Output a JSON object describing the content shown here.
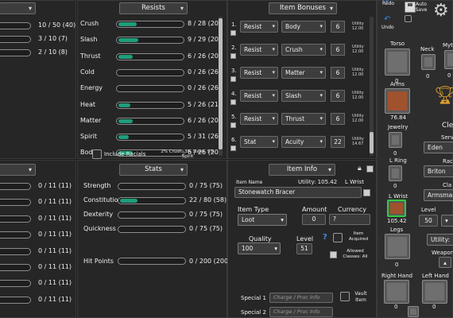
{
  "top_left": {
    "values": [
      "10 / 50 (40)",
      "3 / 10 (7)",
      "2 / 10 (8)"
    ]
  },
  "resists": {
    "header": "Resists",
    "rows": [
      {
        "label": "Crush",
        "value": "8 / 28 (20)",
        "fill": 0.29
      },
      {
        "label": "Slash",
        "value": "9 / 29 (20)",
        "fill": 0.31
      },
      {
        "label": "Thrust",
        "value": "6 / 26 (20)",
        "fill": 0.23
      },
      {
        "label": "Cold",
        "value": "0 / 26 (26)",
        "fill": 0
      },
      {
        "label": "Energy",
        "value": "0 / 26 (26)",
        "fill": 0
      },
      {
        "label": "Heat",
        "value": "5 / 26 (21)",
        "fill": 0.19
      },
      {
        "label": "Matter",
        "value": "6 / 26 (20)",
        "fill": 0.23
      },
      {
        "label": "Spirit",
        "value": "5 / 31 (26)",
        "fill": 0.16
      },
      {
        "label": "Body",
        "value": "6 / 26 (20)",
        "fill": 0.23
      }
    ],
    "include_racials": "Include Racials",
    "racial_note": "2% Crush, 3% Slash, 5% Spirit"
  },
  "item_bonuses": {
    "header": "Item Bonuses",
    "rows": [
      {
        "num": "1.",
        "type": "Resist",
        "target": "Body",
        "value": "6",
        "utility_label": "Utility",
        "utility": "12.00"
      },
      {
        "num": "2.",
        "type": "Resist",
        "target": "Crush",
        "value": "6",
        "utility_label": "Utility",
        "utility": "12.00"
      },
      {
        "num": "3.",
        "type": "Resist",
        "target": "Matter",
        "value": "6",
        "utility_label": "Utility",
        "utility": "12.00"
      },
      {
        "num": "4.",
        "type": "Resist",
        "target": "Slash",
        "value": "6",
        "utility_label": "Utility",
        "utility": "12.00"
      },
      {
        "num": "5.",
        "type": "Resist",
        "target": "Thrust",
        "value": "6",
        "utility_label": "Utility",
        "utility": "12.00"
      },
      {
        "num": "6.",
        "type": "Stat",
        "target": "Acuity",
        "value": "22",
        "utility_label": "Utility",
        "utility": "14.67"
      }
    ]
  },
  "toolbar": {
    "redo": "Redo",
    "auto_save": "Auto Save",
    "undo": "Undo"
  },
  "bottom_left": {
    "values": [
      "0 / 11 (11)",
      "0 / 11 (11)",
      "0 / 11 (11)",
      "0 / 11 (11)",
      "0 / 11 (11)",
      "0 / 11 (11)",
      "0 / 11 (11)",
      "0 / 11 (11)"
    ]
  },
  "stats": {
    "header": "Stats",
    "rows": [
      {
        "label": "Strength",
        "value": "0 / 75 (75)",
        "fill": 0
      },
      {
        "label": "Constitution",
        "value": "22 / 80 (58)",
        "fill": 0.275
      },
      {
        "label": "Dexterity",
        "value": "0 / 75 (75)",
        "fill": 0
      },
      {
        "label": "Quickness",
        "value": "0 / 75 (75)",
        "fill": 0
      }
    ],
    "hit_points": {
      "label": "Hit Points",
      "value": "0 / 200 (200)",
      "fill": 0
    }
  },
  "item_info": {
    "header": "Item Info",
    "item_name_label": "Item Name",
    "utility_label": "Utility: 105.42",
    "slot_label": "L Wrist",
    "item_name": "Stonewatch Bracer",
    "item_type_label": "Item Type",
    "item_type": "Loot",
    "amount_label": "Amount",
    "amount": "0",
    "currency_label": "Currency",
    "currency": "?",
    "quality_label": "Quality",
    "quality": "100",
    "level_label": "Level",
    "level": "51",
    "help": "?",
    "item_acquired": "Item Acquired",
    "allowed_classes": "Allowed Classes: All",
    "special1_label": "Special 1",
    "special2_label": "Special 2",
    "special_placeholder": "Charge / Proc Info",
    "vault_item": "Vault Item"
  },
  "equipment": {
    "torso": "Torso",
    "neck": "Neck",
    "myth": "Myth",
    "arms": "Arms",
    "arms_value": "76.84",
    "jewelry": "Jewelry",
    "l_ring": "L Ring",
    "l_wrist": "L Wrist",
    "l_wrist_value": "105.42",
    "legs": "Legs",
    "right_hand": "Right Hand",
    "left_hand": "Left Hand",
    "zero": "0",
    "level_label": "Level",
    "level_value": "50",
    "utility_btn": "Utility:",
    "weapons_label": "Weapon",
    "cle_label": "Cle",
    "server_label": "Serv",
    "server": "Eden",
    "race_label": "Rac",
    "race": "Briton",
    "class_label": "Cla",
    "class": "Armsman"
  },
  "colors": {
    "accent": "#1f9d7a",
    "panel": "#262626",
    "highlight_slot": "#2ecc40",
    "arms_item": "#a0522d"
  }
}
